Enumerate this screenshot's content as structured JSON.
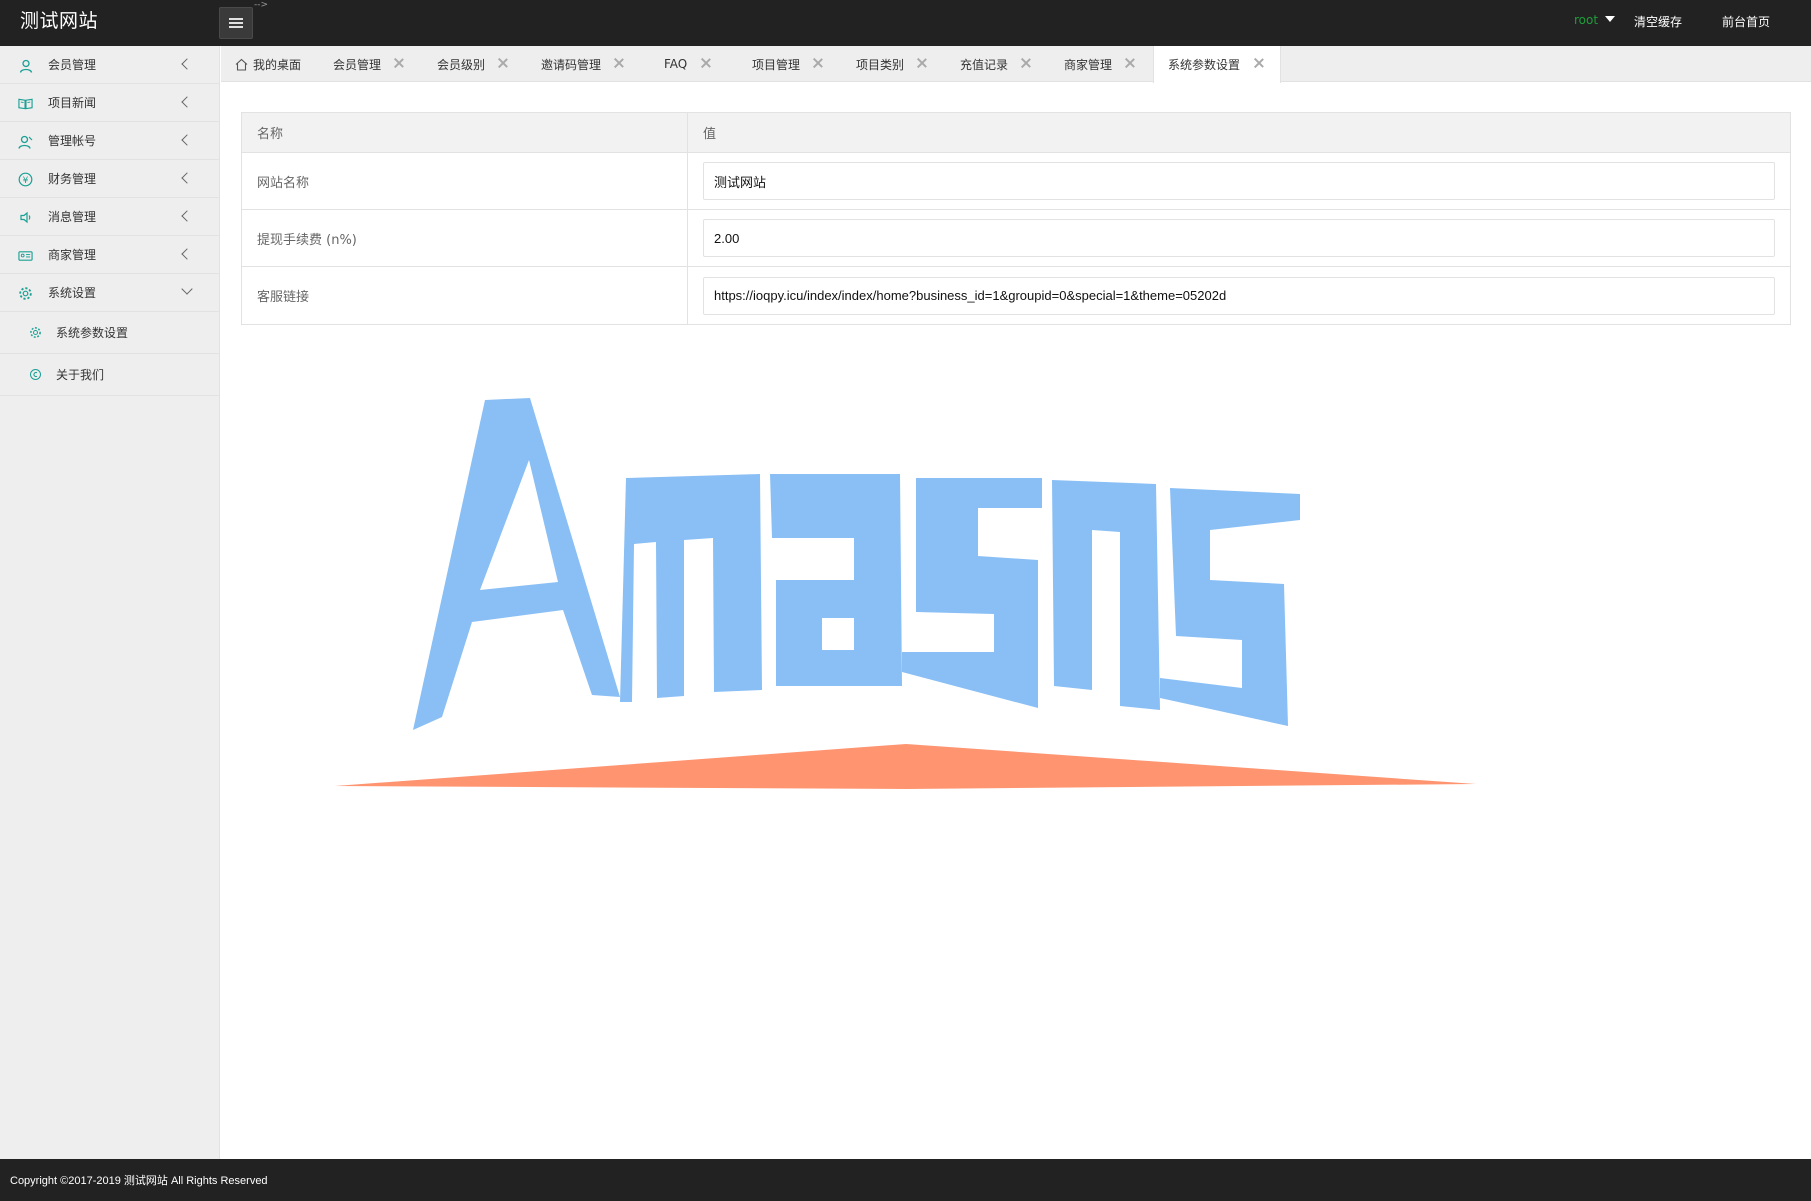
{
  "header": {
    "logo": "测试网站",
    "stray_text": "-->",
    "user": "root",
    "clear_cache": "清空缓存",
    "front_home": "前台首页"
  },
  "sidebar": {
    "items": [
      {
        "label": "会员管理",
        "icon": "user-icon"
      },
      {
        "label": "项目新闻",
        "icon": "book-icon"
      },
      {
        "label": "管理帐号",
        "icon": "admin-user-icon"
      },
      {
        "label": "财务管理",
        "icon": "yen-icon"
      },
      {
        "label": "消息管理",
        "icon": "speaker-icon"
      },
      {
        "label": "商家管理",
        "icon": "card-icon"
      },
      {
        "label": "系统设置",
        "icon": "gear-icon",
        "expanded": true
      }
    ],
    "sub_items": [
      {
        "label": "系统参数设置",
        "icon": "gear-small-icon"
      },
      {
        "label": "关于我们",
        "icon": "info-circle-icon"
      }
    ]
  },
  "tabs": [
    {
      "label": "我的桌面",
      "icon": "home-icon",
      "closable": false
    },
    {
      "label": "会员管理",
      "closable": true
    },
    {
      "label": "会员级别",
      "closable": true
    },
    {
      "label": "邀请码管理",
      "closable": true
    },
    {
      "label": "FAQ",
      "closable": true
    },
    {
      "label": "项目管理",
      "closable": true
    },
    {
      "label": "项目类别",
      "closable": true
    },
    {
      "label": "充值记录",
      "closable": true
    },
    {
      "label": "商家管理",
      "closable": true
    },
    {
      "label": "系统参数设置",
      "closable": true,
      "active": true
    }
  ],
  "table": {
    "headers": [
      "名称",
      "值"
    ],
    "rows": [
      {
        "name": "网站名称",
        "value": "测试网站"
      },
      {
        "name": "提现手续费 (n%)",
        "value": "2.00"
      },
      {
        "name": "客服链接",
        "value": "https://ioqpy.icu/index/index/home?business_id=1&groupid=0&special=1&theme=05202d"
      }
    ]
  },
  "watermark": {
    "text": "Amasns",
    "text_color": "#89bff5",
    "swoosh_color": "#ff9470"
  },
  "footer": {
    "copyright": "Copyright ©2017-2019 测试网站 All Rights Reserved"
  },
  "colors": {
    "header_bg": "#222222",
    "sidebar_bg": "#eeeeee",
    "icon_accent": "#1aa094",
    "user_green": "#1e9e3a"
  }
}
